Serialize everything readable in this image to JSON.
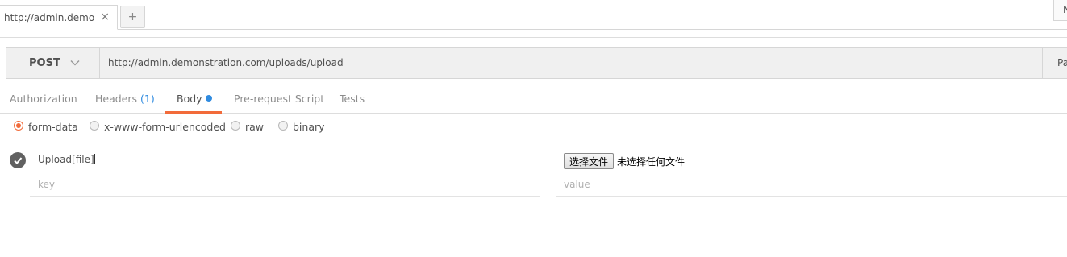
{
  "tabs": {
    "active_tab_title": "http://admin.demonstration.com/uploads/upload",
    "close_icon": "×",
    "add_icon": "+",
    "env_button_label": "N"
  },
  "request": {
    "method": "POST",
    "url": "http://admin.demonstration.com/uploads/upload",
    "params_label": "Pa"
  },
  "subtabs": {
    "authorization": "Authorization",
    "headers": "Headers",
    "headers_count": "(1)",
    "body": "Body",
    "prerequest": "Pre-request Script",
    "tests": "Tests",
    "accent_color": "#f26b3a",
    "indicator_color": "#2f8be0"
  },
  "body_types": [
    {
      "label": "form-data",
      "selected": true
    },
    {
      "label": "x-www-form-urlencoded",
      "selected": false
    },
    {
      "label": "raw",
      "selected": false
    },
    {
      "label": "binary",
      "selected": false
    }
  ],
  "form_rows": {
    "row1_key": "Upload[file]",
    "choose_file_button": "选择文件",
    "no_file_text": "未选择任何文件",
    "key_placeholder": "key",
    "value_placeholder": "value"
  }
}
